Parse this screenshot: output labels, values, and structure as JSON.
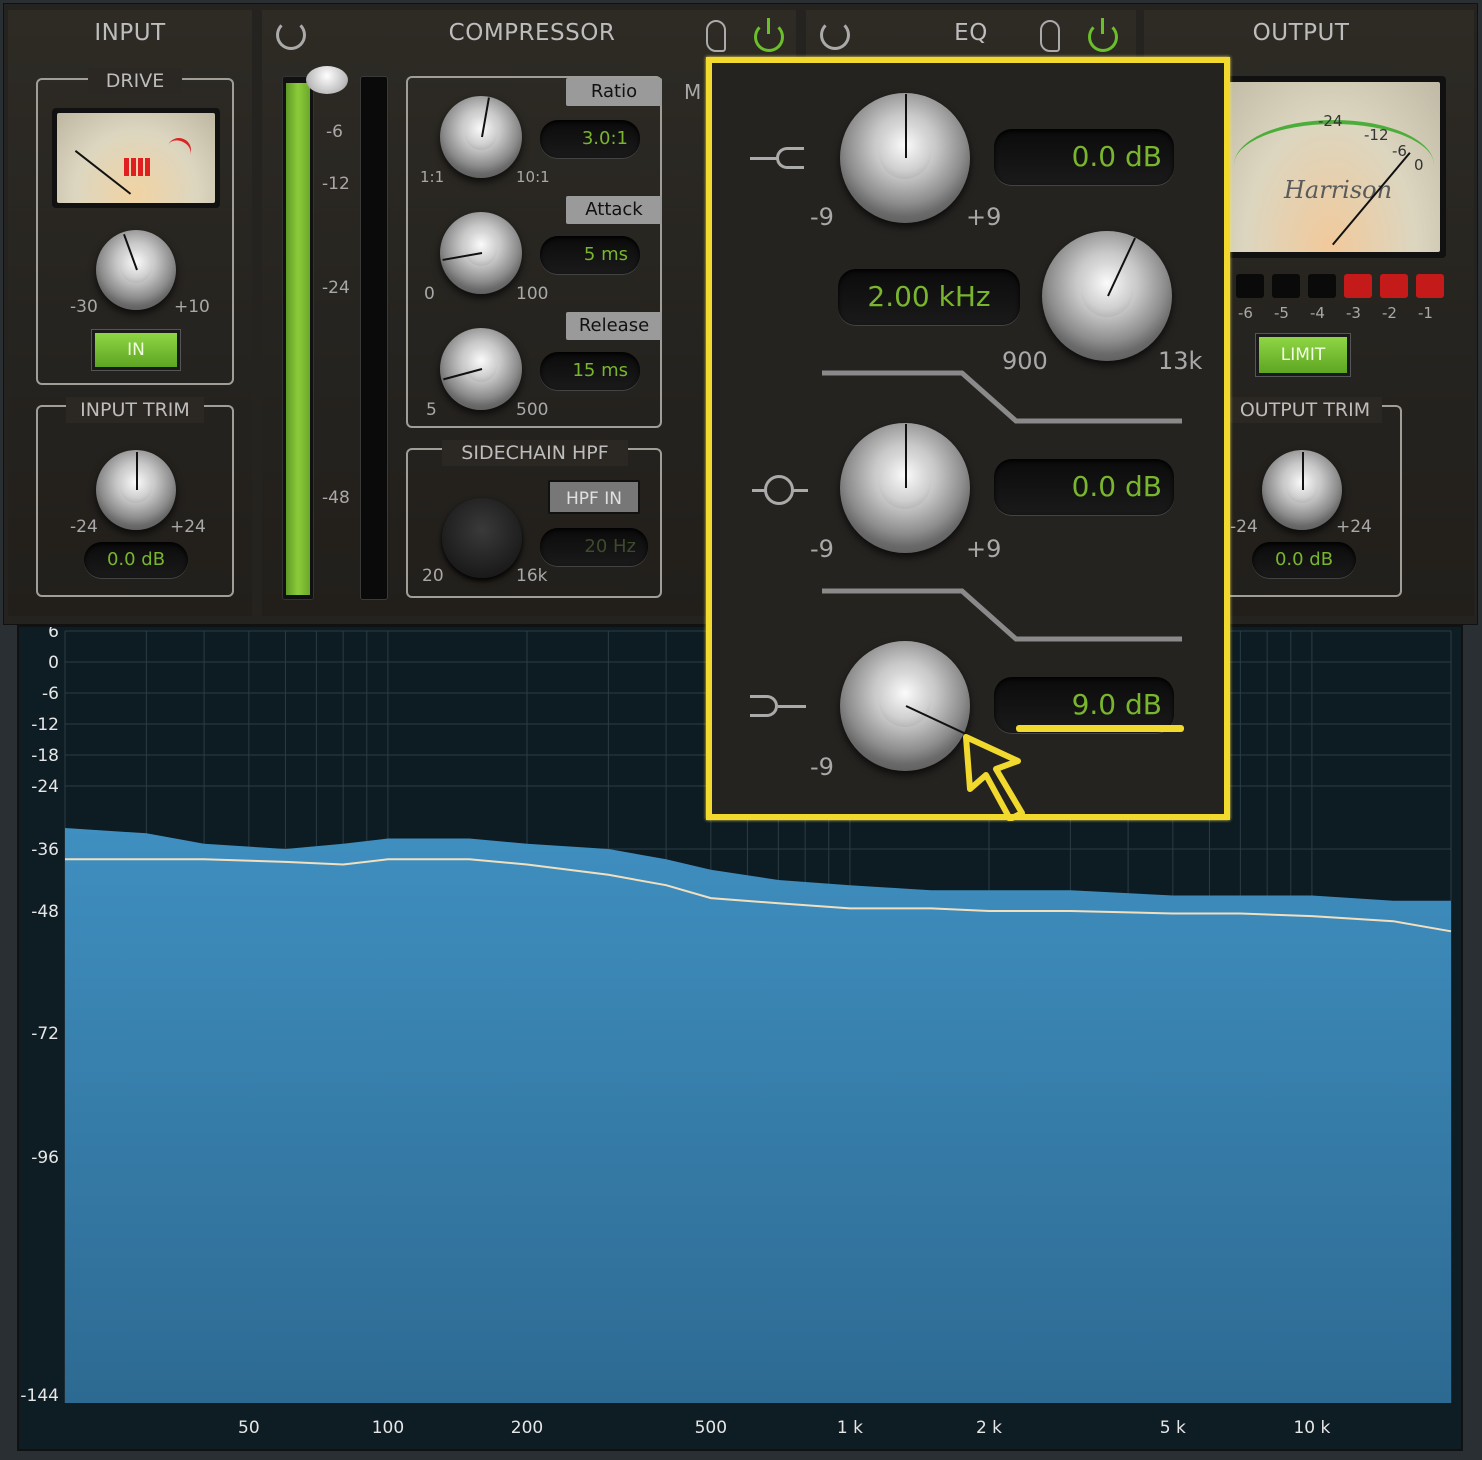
{
  "input": {
    "title": "INPUT",
    "drive_title": "DRIVE",
    "drive_min": "-30",
    "drive_max": "+10",
    "in_button": "IN",
    "trim_title": "INPUT TRIM",
    "trim_min": "-24",
    "trim_max": "+24",
    "trim_value": "0.0 dB"
  },
  "compressor": {
    "title": "COMPRESSOR",
    "meter_ticks": [
      "-6",
      "-12",
      "-24",
      "-48"
    ],
    "ratio_label": "Ratio",
    "ratio_value": "3.0:1",
    "ratio_min": "1:1",
    "ratio_max": "10:1",
    "attack_label": "Attack",
    "attack_value": "5 ms",
    "attack_min": "0",
    "attack_max": "100",
    "release_label": "Release",
    "release_value": "15 ms",
    "release_min": "5",
    "release_max": "500",
    "sidechain_title": "SIDECHAIN HPF",
    "hpf_button": "HPF IN",
    "hpf_value": "20 Hz",
    "hpf_min": "20",
    "hpf_max": "16k",
    "makeup_partial": "M"
  },
  "eq": {
    "title": "EQ",
    "high_gain": "0.0 dB",
    "high_min": "-9",
    "high_max": "+9",
    "freq_value": "2.00 kHz",
    "freq_min": "900",
    "freq_max": "13k",
    "mid_gain": "0.0 dB",
    "mid_min": "-9",
    "mid_max": "+9",
    "low_gain": "9.0 dB",
    "low_min": "-9"
  },
  "output": {
    "title": "OUTPUT",
    "brand": "Harrison",
    "vu_labels": [
      "-24",
      "-12",
      "-6",
      "0"
    ],
    "led_labels": [
      "-6",
      "-5",
      "-4",
      "-3",
      "-2",
      "-1"
    ],
    "limit_button": "LIMIT",
    "trim_title": "OUTPUT TRIM",
    "trim_min": "-24",
    "trim_max": "+24",
    "trim_value": "0.0 dB"
  },
  "colors": {
    "accent_green": "#79b52d",
    "annotation_yellow": "#f2d92e",
    "spectrum_blue": "#3f8fc0"
  },
  "chart_data": {
    "type": "area",
    "x_scale": "log",
    "xlim": [
      20,
      20000
    ],
    "ylim": [
      -144,
      6
    ],
    "x_ticks": [
      "50",
      "100",
      "200",
      "500",
      "1 k",
      "2 k",
      "5 k",
      "10 k"
    ],
    "y_ticks": [
      "6",
      "0",
      "-6",
      "-12",
      "-18",
      "-24",
      "-36",
      "-48",
      "-72",
      "-96",
      "-144"
    ],
    "x": [
      20,
      30,
      40,
      60,
      80,
      100,
      150,
      200,
      300,
      400,
      500,
      700,
      1000,
      1500,
      2000,
      3000,
      5000,
      7000,
      10000,
      15000,
      20000
    ],
    "series": [
      {
        "values": [
          -32,
          -33,
          -35,
          -36,
          -35,
          -34,
          -34,
          -35,
          -36,
          -38,
          -40,
          -42,
          -43,
          -44,
          -44,
          -44,
          -45,
          -45,
          -45,
          -46,
          -46
        ]
      },
      {
        "values": [
          -38,
          -38,
          -38,
          -38.5,
          -39,
          -38,
          -38,
          -39,
          -41,
          -43,
          -45.5,
          -46.5,
          -47.5,
          -47.5,
          -48,
          -48,
          -48.5,
          -48.5,
          -49,
          -50,
          -52
        ]
      }
    ]
  }
}
